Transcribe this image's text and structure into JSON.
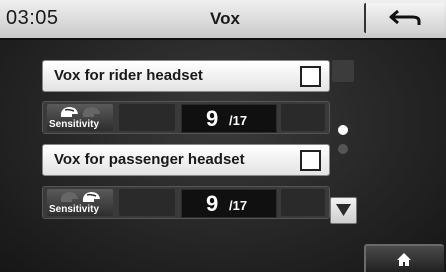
{
  "header": {
    "time": "03:05",
    "title": "Vox",
    "back_icon": "back-arrow-icon"
  },
  "vox_rows": [
    {
      "label": "Vox for rider headset",
      "checked": false,
      "sensitivity_label": "Sensitivity",
      "sensitivity_value": "9",
      "sensitivity_max": "/17",
      "active_helmet": "rider"
    },
    {
      "label": "Vox for passenger headset",
      "checked": false,
      "sensitivity_label": "Sensitivity",
      "sensitivity_value": "9",
      "sensitivity_max": "/17",
      "active_helmet": "passenger"
    }
  ],
  "scroll": {
    "up_icon": "scroll-up-icon",
    "down_icon": "scroll-down-icon",
    "current_page": 1,
    "page_count": 2
  },
  "footer": {
    "home_icon": "home-icon"
  },
  "colors": {
    "header_bg": "#e0e0e0",
    "screen_bg": "#262626",
    "value_bg": "#101010",
    "text_light": "#ffffff",
    "text_dark": "#1a1a1a"
  }
}
